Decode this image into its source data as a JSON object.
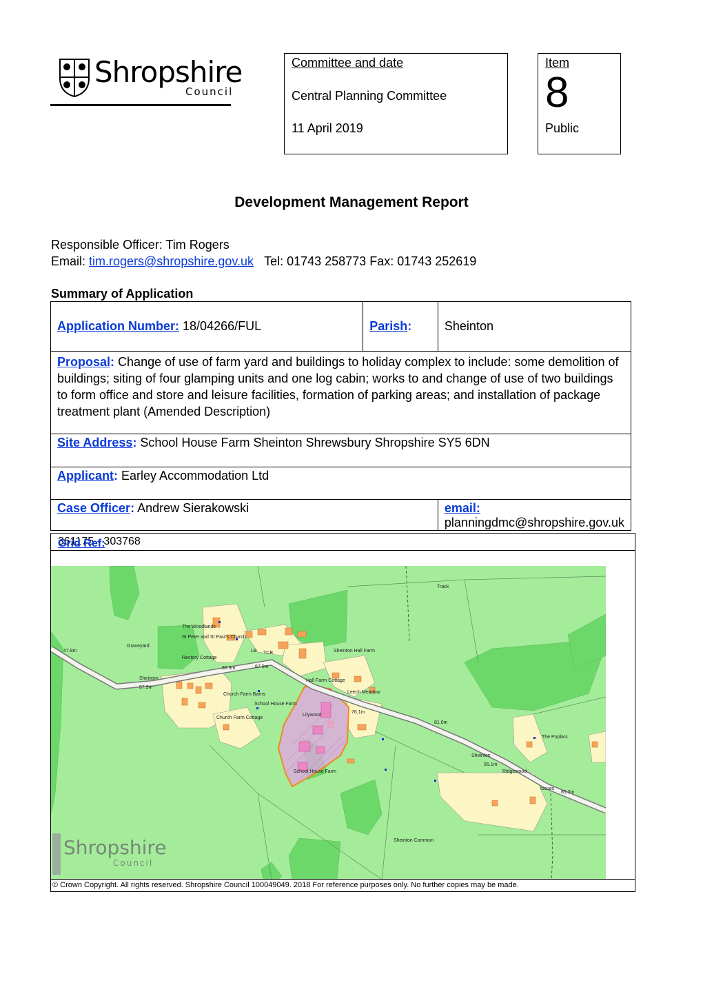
{
  "logo": {
    "name": "Shropshire",
    "sub": "Council"
  },
  "committee": {
    "heading": "Committee and date",
    "name": "Central Planning Committee",
    "date": "11 April 2019"
  },
  "item": {
    "heading": "Item",
    "number": "8",
    "status": "Public"
  },
  "report_title": "Development Management Report",
  "officer": {
    "line": "Responsible Officer: Tim Rogers",
    "email_label": "Email: ",
    "email": "tim.rogers@shropshire.gov.uk",
    "contact": "Tel: 01743 258773   Fax: 01743 252619"
  },
  "summary_heading": "Summary of Application",
  "summary": {
    "app_number_label": "Application Number:",
    "app_number": "18/04266/FUL",
    "parish_label": "Parish",
    "parish": "Sheinton",
    "proposal_label": "Proposal",
    "proposal": "Change of use of farm yard and buildings to holiday complex to include: some demolition of buildings; siting of four glamping units and one log cabin; works to and change of use of two buildings to form office and store and leisure facilities, formation of parking areas; and installation of package treatment plant (Amended Description)",
    "site_label": "Site Address",
    "site": "School House Farm Sheinton Shrewsbury Shropshire SY5 6DN",
    "applicant_label": "Applicant",
    "applicant": "Earley Accommodation Ltd",
    "case_officer_label": "Case Officer",
    "case_officer": "Andrew Sierakowski",
    "email_label": "email:",
    "email": "planningdmc@shropshire.gov.uk"
  },
  "map": {
    "grid_ref_label": "Grid Ref:",
    "grid_ref": "361175 - 303768",
    "copyright": "© Crown Copyright. All rights reserved.  Shropshire Council 100049049. 2018  For reference purposes only. No further copies may be made.",
    "watermark_name": "Shropshire",
    "watermark_sub": "Council",
    "labels": {
      "track": "Track",
      "woodlands": "The Woodlands",
      "church": "St Peter and St Paul's Church",
      "graveyard": "Graveyard",
      "rectory": "Rectory Cottage",
      "hall_farm": "Sheinton Hall Farm",
      "hall_cottage": "Hall Farm Cottage",
      "leech": "Leech Meadow",
      "church_barns": "Church Farm Barns",
      "school_house": "School House Farm",
      "church_cottage": "Church Farm Cottage",
      "lilywood": "Lilywood",
      "school_farm": "School House Farm",
      "sheinton": "Sheinton",
      "poplars": "The Poplars",
      "ridgewood": "Ridgewood",
      "common": "Sheinton Common",
      "issues": "Issues",
      "lb": "LB",
      "tcb": "TCB",
      "h1": "47.8m",
      "h2": "57.9m",
      "h3": "60.9m",
      "h4": "67.0m",
      "h5": "76.1m",
      "h6": "81.0m",
      "h7": "95.1m",
      "h8": "85.3m"
    }
  }
}
